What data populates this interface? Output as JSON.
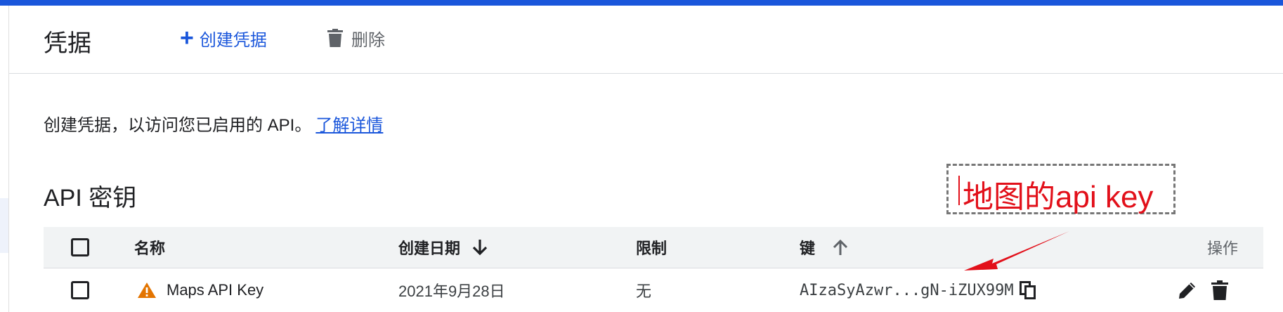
{
  "header": {
    "title": "凭据",
    "create_label": "创建凭据",
    "delete_label": "删除"
  },
  "intro": {
    "text": "创建凭据，以访问您已启用的 API。",
    "learn_more": "了解详情"
  },
  "section": {
    "title": "API 密钥"
  },
  "annotation": {
    "text": "地图的api key",
    "color": "#e2101a"
  },
  "table": {
    "columns": {
      "name": "名称",
      "created": "创建日期",
      "restriction": "限制",
      "key": "键",
      "actions": "操作"
    },
    "rows": [
      {
        "name": "Maps API Key",
        "created": "2021年9月28日",
        "restriction": "无",
        "key": "AIzaSyAzwr...gN-iZUX99M"
      }
    ]
  },
  "colors": {
    "accent": "#1a56db",
    "warning": "#e37400",
    "annotation": "#e2101a"
  },
  "icons": {
    "create": "plus-icon",
    "delete": "trash-icon",
    "created_sort": "arrow-down-icon",
    "key_sort": "arrow-up-icon",
    "row_status": "warning-icon",
    "copy": "copy-icon",
    "edit": "pencil-icon",
    "row_delete": "trash-icon"
  }
}
